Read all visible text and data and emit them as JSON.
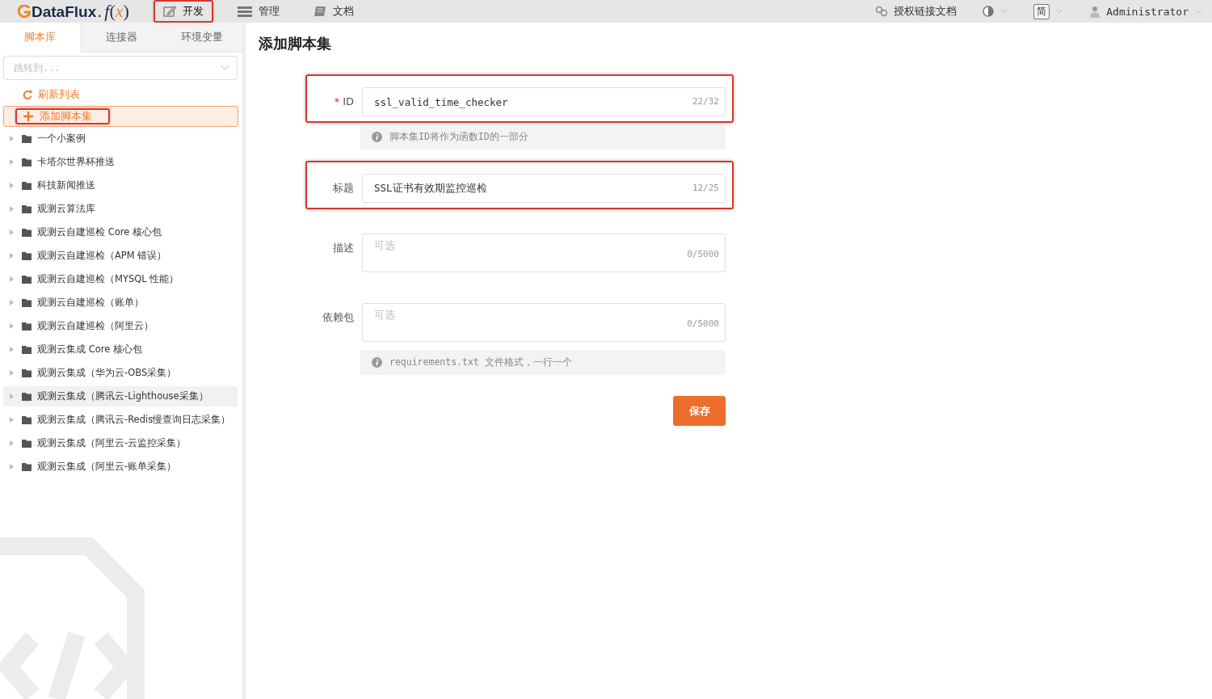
{
  "topbar": {
    "logo": {
      "brand": "DataFlux",
      "suffix": ".",
      "func": "f",
      "paren_open": "(",
      "var": "x",
      "paren_close": ")"
    },
    "nav": [
      {
        "label": "开发",
        "selected": true,
        "annotated": true
      },
      {
        "label": "管理",
        "selected": false,
        "annotated": false
      },
      {
        "label": "文档",
        "selected": false,
        "annotated": false
      }
    ],
    "auth_link": "授权链接文档",
    "language": "简",
    "user": "Administrator"
  },
  "sidebar": {
    "tabs": [
      {
        "label": "脚本库",
        "selected": true
      },
      {
        "label": "连接器",
        "selected": false
      },
      {
        "label": "环境变量",
        "selected": false
      }
    ],
    "jump": {
      "placeholder": "跳转到..."
    },
    "refresh": "刷新列表",
    "add": {
      "label": "添加脚本集",
      "selected": true,
      "annotated": true
    },
    "items": [
      {
        "label": "一个小案例",
        "hovered": false
      },
      {
        "label": "卡塔尔世界杯推送",
        "hovered": false
      },
      {
        "label": "科技新闻推送",
        "hovered": false
      },
      {
        "label": "观测云算法库",
        "hovered": false
      },
      {
        "label": "观测云自建巡检 Core 核心包",
        "hovered": false
      },
      {
        "label": "观测云自建巡检（APM 错误）",
        "hovered": false
      },
      {
        "label": "观测云自建巡检（MYSQL 性能）",
        "hovered": false
      },
      {
        "label": "观测云自建巡检（账单）",
        "hovered": false
      },
      {
        "label": "观测云自建巡检（阿里云）",
        "hovered": false
      },
      {
        "label": "观测云集成 Core 核心包",
        "hovered": false
      },
      {
        "label": "观测云集成（华为云-OBS采集）",
        "hovered": false
      },
      {
        "label": "观测云集成（腾讯云-Lighthouse采集）",
        "hovered": true
      },
      {
        "label": "观测云集成（腾讯云-Redis慢查询日志采集）",
        "hovered": false
      },
      {
        "label": "观测云集成（阿里云-云监控采集）",
        "hovered": false
      },
      {
        "label": "观测云集成（阿里云-账单采集）",
        "hovered": false
      }
    ]
  },
  "form": {
    "title": "添加脚本集",
    "fields": [
      {
        "kind": "input",
        "label": "ID",
        "required_mark": "*",
        "annotated": true,
        "value": "ssl_valid_time_checker",
        "count": "22/32",
        "hint": "脚本集ID将作为函数ID的一部分"
      },
      {
        "kind": "input",
        "label": "标题",
        "annotated": true,
        "value": "SSL证书有效期监控巡检",
        "count": "12/25"
      },
      {
        "kind": "textarea",
        "label": "描述",
        "annotated": false,
        "placeholder": "可选",
        "count": "0/5000"
      },
      {
        "kind": "textarea",
        "label": "依赖包",
        "annotated": false,
        "placeholder": "可选",
        "count": "0/5000",
        "hint": "requirements.txt 文件格式，一行一个"
      }
    ],
    "save": "保存"
  }
}
